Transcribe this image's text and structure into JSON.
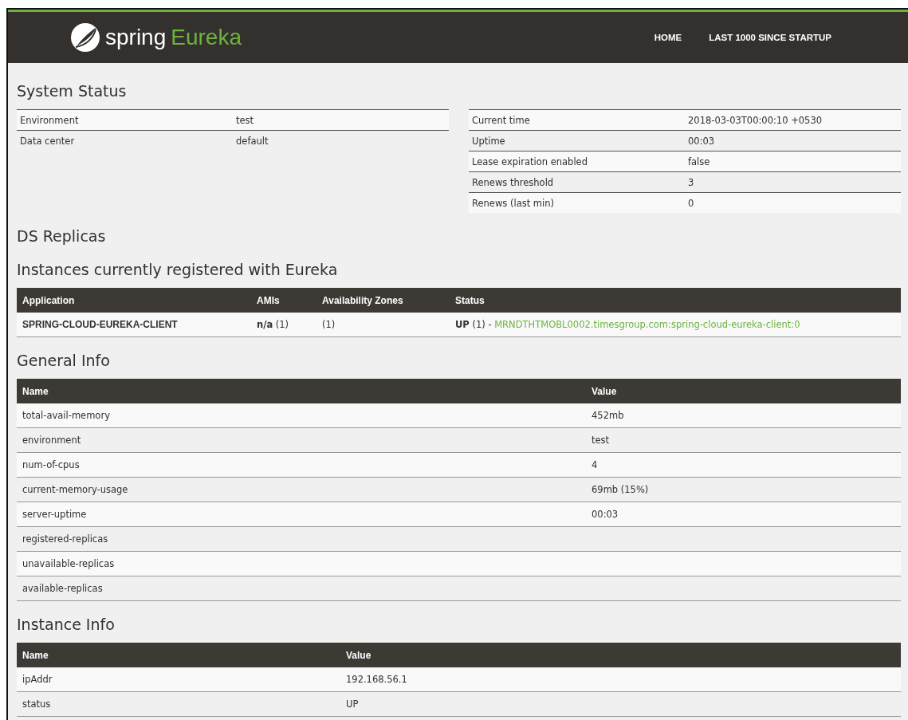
{
  "navbar": {
    "brand": "spring",
    "product": "Eureka",
    "links": [
      "HOME",
      "LAST 1000 SINCE STARTUP"
    ]
  },
  "system_status": {
    "title": "System Status",
    "left": [
      {
        "name": "Environment",
        "value": "test"
      },
      {
        "name": "Data center",
        "value": "default"
      }
    ],
    "right": [
      {
        "name": "Current time",
        "value": "2018-03-03T00:00:10 +0530"
      },
      {
        "name": "Uptime",
        "value": "00:03"
      },
      {
        "name": "Lease expiration enabled",
        "value": "false"
      },
      {
        "name": "Renews threshold",
        "value": "3"
      },
      {
        "name": "Renews (last min)",
        "value": "0"
      }
    ]
  },
  "ds_replicas": {
    "title": "DS Replicas"
  },
  "instances": {
    "title": "Instances currently registered with Eureka",
    "columns": [
      "Application",
      "AMIs",
      "Availability Zones",
      "Status"
    ],
    "rows": [
      {
        "application": "SPRING-CLOUD-EUREKA-CLIENT",
        "amis": "**n/a** (1)",
        "zones": "(1)",
        "status": "**UP** (1) - ",
        "instance_link": "MRNDTHTMOBL0002.timesgroup.com:spring-cloud-eureka-client:0"
      }
    ]
  },
  "general_info": {
    "title": "General Info",
    "columns": [
      "Name",
      "Value"
    ],
    "rows": [
      [
        "total-avail-memory",
        "452mb"
      ],
      [
        "environment",
        "test"
      ],
      [
        "num-of-cpus",
        "4"
      ],
      [
        "current-memory-usage",
        "69mb (15%)"
      ],
      [
        "server-uptime",
        "00:03"
      ],
      [
        "registered-replicas",
        ""
      ],
      [
        "unavailable-replicas",
        ""
      ],
      [
        "available-replicas",
        ""
      ]
    ]
  },
  "instance_info": {
    "title": "Instance Info",
    "columns": [
      "Name",
      "Value"
    ],
    "rows": [
      [
        "ipAddr",
        "192.168.56.1"
      ],
      [
        "status",
        "UP"
      ]
    ]
  }
}
